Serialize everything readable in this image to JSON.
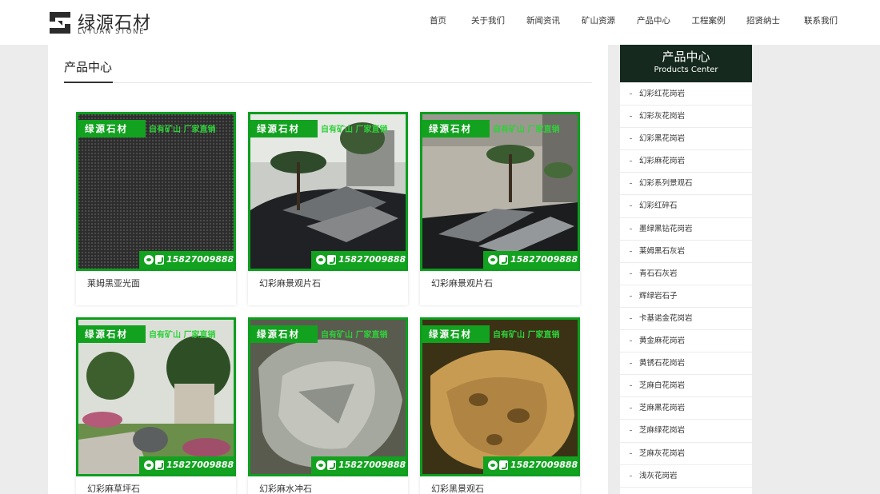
{
  "header": {
    "logo_cn": "绿源石材",
    "logo_en": "LVYUAN STONE",
    "nav": [
      "首页",
      "关于我们",
      "新闻资讯",
      "矿山资源",
      "产品中心",
      "工程案例",
      "招贤纳士",
      "联系我们"
    ]
  },
  "main": {
    "title": "产品中心",
    "watermark": {
      "brand": "绿源石材",
      "slogan": "自有矿山  厂家直销",
      "phone": "15827009888"
    },
    "products": [
      {
        "caption": "莱姆黑亚光面",
        "scene": "dark-slab"
      },
      {
        "caption": "幻彩麻景观片石",
        "scene": "garden-dark"
      },
      {
        "caption": "幻彩麻景观片石",
        "scene": "garden-wall"
      },
      {
        "caption": "幻彩麻草坪石",
        "scene": "lawn"
      },
      {
        "caption": "幻彩麻水冲石",
        "scene": "grey-boulder"
      },
      {
        "caption": "幻彩黑景观石",
        "scene": "brown-rock"
      }
    ]
  },
  "sidebar": {
    "title_cn": "产品中心",
    "title_en": "Products Center",
    "items": [
      "幻彩红花岗岩",
      "幻彩灰花岗岩",
      "幻彩黑花岗岩",
      "幻彩麻花岗岩",
      "幻彩系列景观石",
      "幻彩红碎石",
      "墨绿黑钻花岗岩",
      "莱姆黑石灰岩",
      "青石石灰岩",
      "辉绿岩石子",
      "卡基诺金花岗岩",
      "黄金麻花岗岩",
      "黄锈石花岗岩",
      "芝麻白花岗岩",
      "芝麻黑花岗岩",
      "芝麻绿花岗岩",
      "芝麻灰花岗岩",
      "浅灰花岗岩"
    ]
  },
  "colors": {
    "watermark_green": "#12a21f",
    "sidebar_head": "#15291e",
    "page_bg": "#ececec"
  }
}
